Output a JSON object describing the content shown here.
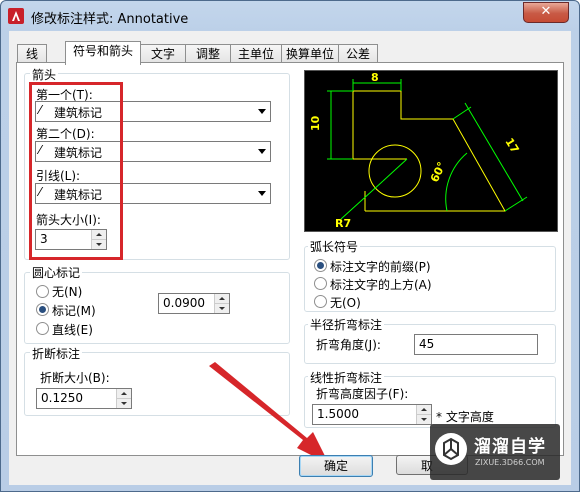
{
  "window": {
    "title": "修改标注样式: Annotative",
    "close_label": "✕"
  },
  "tabs": [
    {
      "label": "线"
    },
    {
      "label": "符号和箭头"
    },
    {
      "label": "文字"
    },
    {
      "label": "调整"
    },
    {
      "label": "主单位"
    },
    {
      "label": "换算单位"
    },
    {
      "label": "公差"
    }
  ],
  "arrows": {
    "group_label": "箭头",
    "first_label": "第一个(T):",
    "first_value": "建筑标记",
    "second_label": "第二个(D):",
    "second_value": "建筑标记",
    "leader_label": "引线(L):",
    "leader_value": "建筑标记",
    "size_label": "箭头大小(I):",
    "size_value": "3"
  },
  "center_marks": {
    "group_label": "圆心标记",
    "options": [
      "无(N)",
      "标记(M)",
      "直线(E)"
    ],
    "selected": "标记(M)",
    "size_value": "0.0900"
  },
  "break": {
    "group_label": "折断标注",
    "size_label": "折断大小(B):",
    "size_value": "0.1250"
  },
  "arc_symbol": {
    "group_label": "弧长符号",
    "options": [
      "标注文字的前缀(P)",
      "标注文字的上方(A)",
      "无(O)"
    ],
    "selected": "标注文字的前缀(P)"
  },
  "radius_jog": {
    "group_label": "半径折弯标注",
    "angle_label": "折弯角度(J):",
    "angle_value": "45"
  },
  "linear_jog": {
    "group_label": "线性折弯标注",
    "factor_label": "折弯高度因子(F):",
    "factor_value": "1.5000",
    "factor_suffix": "* 文字高度"
  },
  "preview": {
    "dim_8": "8",
    "dim_10": "10",
    "dim_17": "17",
    "dim_60": "60°",
    "dim_r7": "R7"
  },
  "buttons": {
    "ok": "确定",
    "cancel": "取"
  },
  "watermark": {
    "title": "溜溜自学",
    "url": "ZIXUE.3D66.COM"
  },
  "colors": {
    "accent": "#d6262a",
    "dim_yellow": "#ffff00",
    "dim_green": "#00ff00"
  }
}
